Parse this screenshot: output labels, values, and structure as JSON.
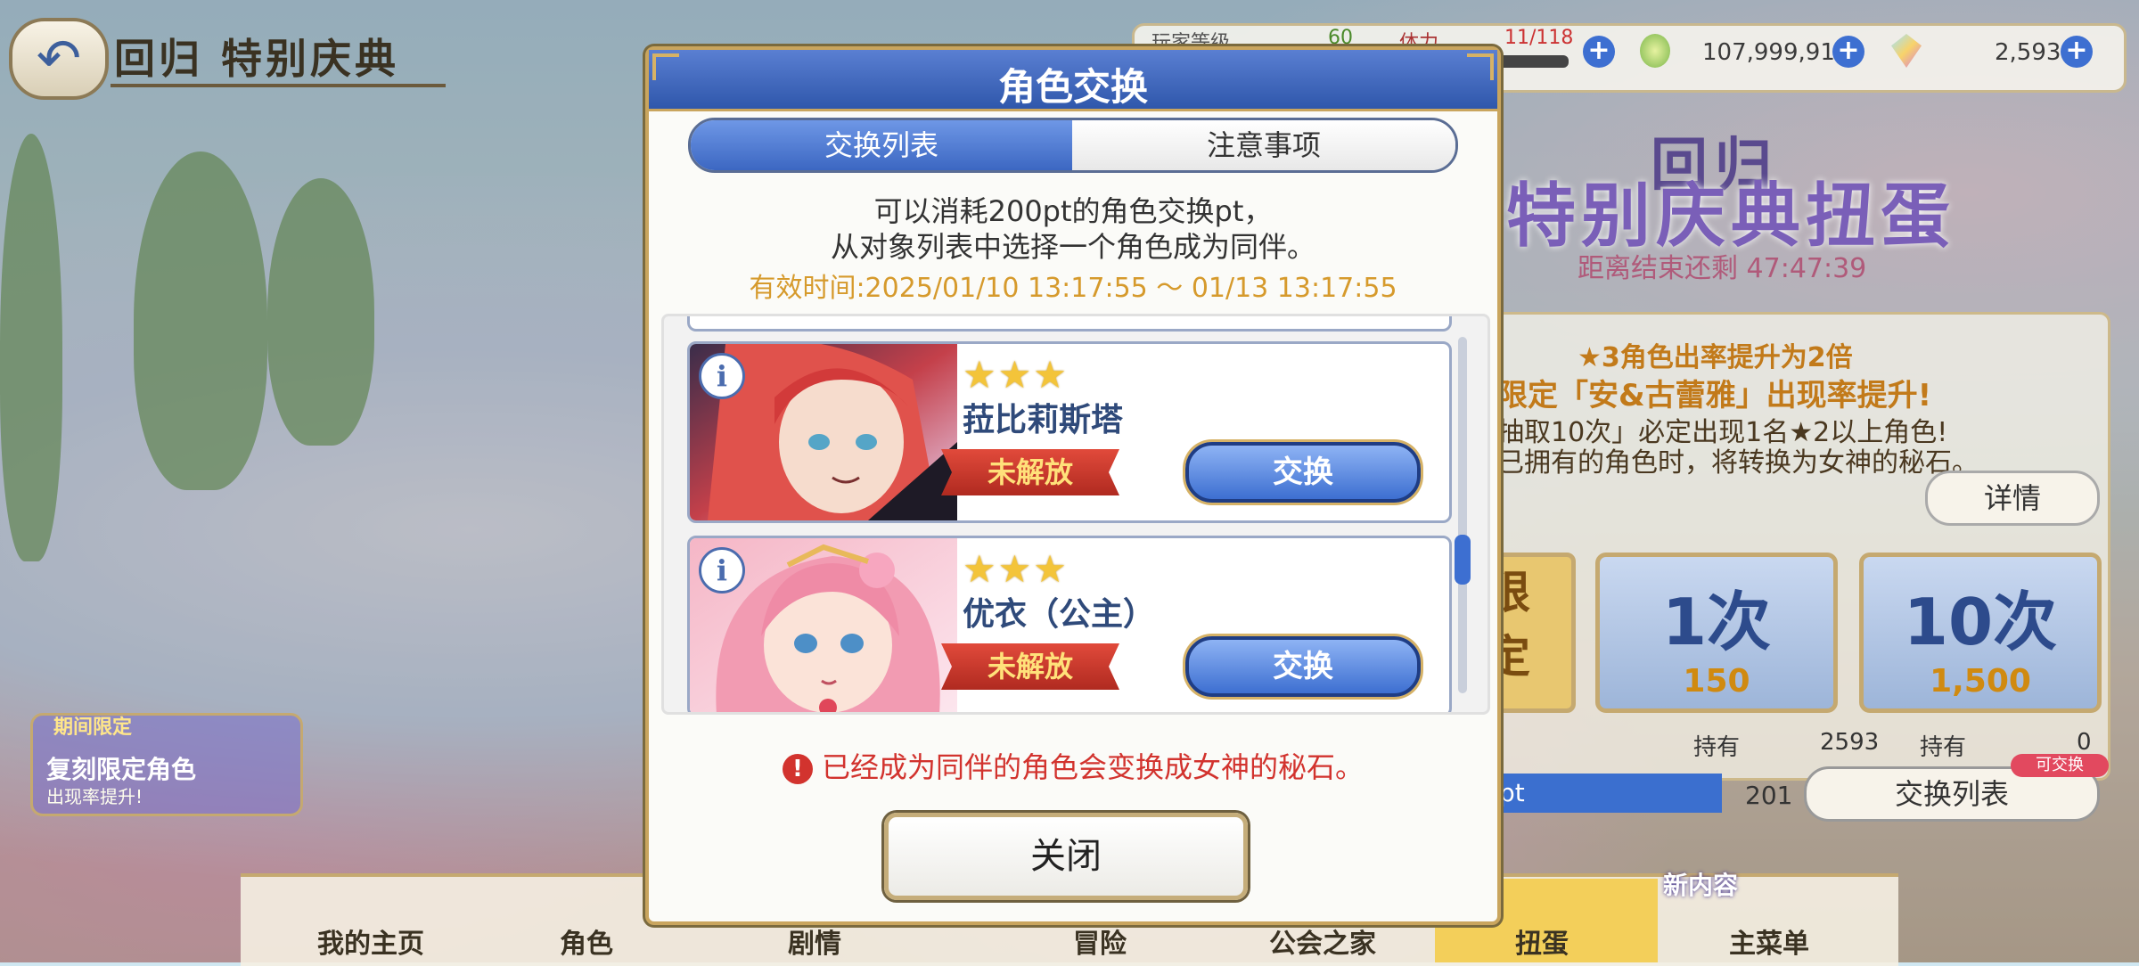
{
  "header": {
    "title": "回归 特别庆典",
    "back_icon": "↶"
  },
  "resources": {
    "player_label": "玩家等级",
    "player_level": "60",
    "stamina_label": "体力",
    "stamina": "11/118",
    "mana": "107,999,917",
    "jewels": "2,593",
    "plus": "+"
  },
  "banner": {
    "top": "回归",
    "main": "特别庆典扭蛋",
    "countdown": "距离结束还剩 47:47:39",
    "lines": [
      "★3角色出率提升为2倍",
      "限定「安&古蕾雅」出现率提升!",
      "抽取10次」必定出现1名★2以上角色!",
      "已拥有的角色时，将转换为女神的秘石。"
    ],
    "detail_label": "详情",
    "limit_label": "限定",
    "single": {
      "count": "1次",
      "cost": "150"
    },
    "ten": {
      "count": "10次",
      "cost": "1,500"
    },
    "owned_left_label": "持有",
    "owned_left_value": "2593",
    "owned_right_label": "持有",
    "owned_right_value": "0",
    "pt_label": "pt",
    "pt_value": "201",
    "exchange_list_label": "交换列表",
    "exchange_badge": "可交换"
  },
  "promo": {
    "tag": "期间限定",
    "title": "复刻限定角色",
    "subtitle": "出现率提升!"
  },
  "nav": {
    "items": [
      "我的主页",
      "角色",
      "剧情",
      "冒险",
      "公会之家",
      "扭蛋",
      "主菜单"
    ],
    "new_label": "新内容"
  },
  "modal": {
    "title": "角色交换",
    "tabs": {
      "active": "交换列表",
      "inactive": "注意事项"
    },
    "desc_line1": "可以消耗200pt的角色交换pt，",
    "desc_line2": "从对象列表中选择一个角色成为同伴。",
    "validity": "有效时间:2025/01/10  13:17:55  ～  01/13  13:17:55",
    "cards": [
      {
        "stars": "★★★",
        "name": "菈比莉斯塔",
        "status": "未解放",
        "button": "交换"
      },
      {
        "stars": "★★★",
        "name": "优衣（公主）",
        "status": "未解放",
        "button": "交换"
      }
    ],
    "info_glyph": "i",
    "notice_icon": "!",
    "notice": "已经成为同伴的角色会变换成女神的秘石。",
    "close_label": "关闭"
  },
  "colors": {
    "header_blue": "#2f57ab",
    "gold_border": "#c9a55e",
    "exchange_blue": "#3d6fd1",
    "locked_red": "#c0392b",
    "notice_red": "#d2332e",
    "validity_orange": "#d69a2c"
  }
}
